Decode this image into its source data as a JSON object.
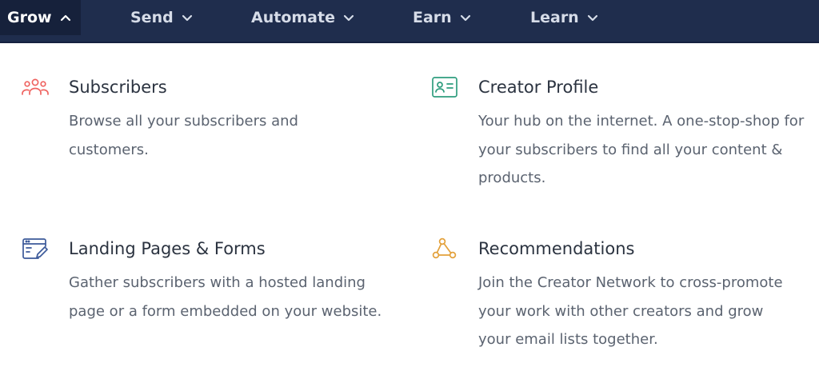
{
  "nav": {
    "items": [
      {
        "label": "Grow",
        "active": true
      },
      {
        "label": "Send",
        "active": false
      },
      {
        "label": "Automate",
        "active": false
      },
      {
        "label": "Earn",
        "active": false
      },
      {
        "label": "Learn",
        "active": false
      }
    ]
  },
  "menu": {
    "cards": [
      {
        "icon": "users-icon",
        "icon_color": "#ef6461",
        "title": "Subscribers",
        "description": "Browse all your subscribers and customers."
      },
      {
        "icon": "id-card-icon",
        "icon_color": "#2f9d7e",
        "title": "Creator Profile",
        "description": "Your hub on the internet. A one-stop-shop for your subscribers to find all your content & products."
      },
      {
        "icon": "form-edit-icon",
        "icon_color": "#3c5a9a",
        "title": "Landing Pages & Forms",
        "description": "Gather subscribers with a hosted landing page or a form embedded on your website."
      },
      {
        "icon": "network-nodes-icon",
        "icon_color": "#e3a13b",
        "title": "Recommendations",
        "description": "Join the Creator Network to cross-promote your work with other creators and grow your email lists together."
      }
    ]
  }
}
